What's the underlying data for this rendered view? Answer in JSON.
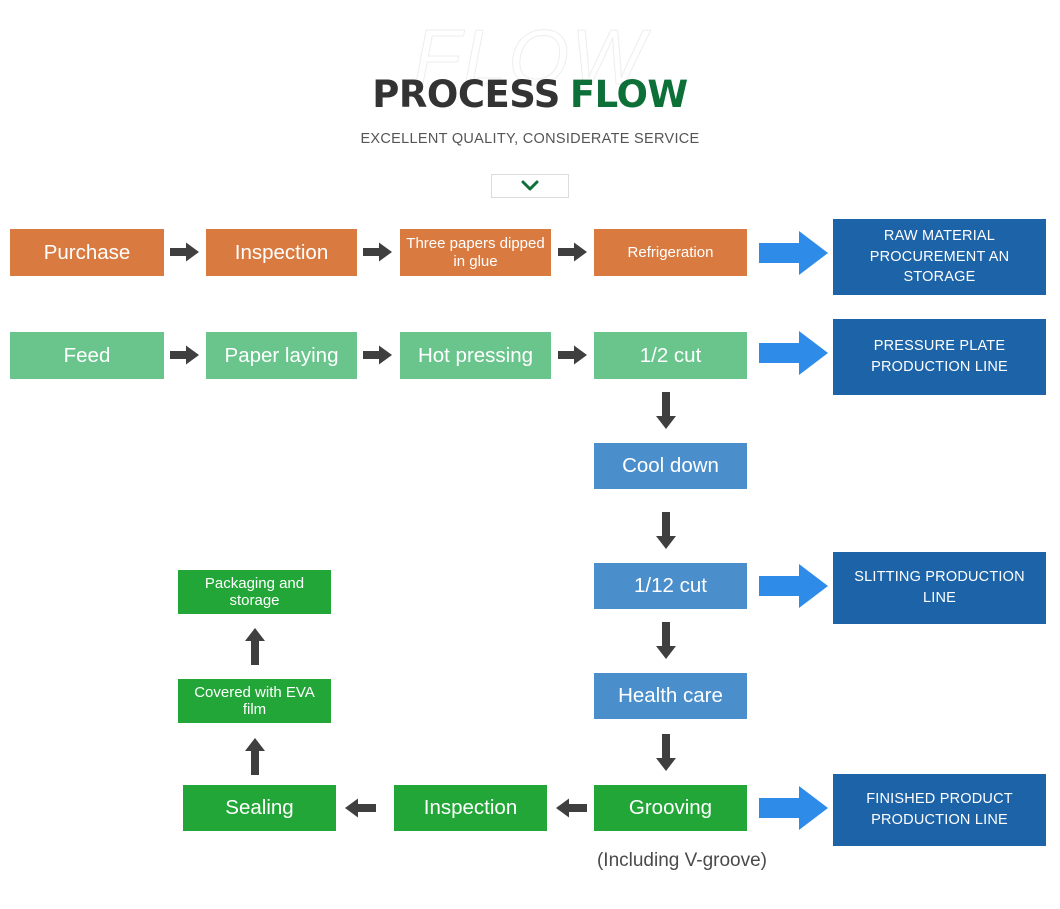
{
  "header": {
    "ghost_title": "FLOW",
    "title_part1": "PROCESS",
    "title_part2": "FLOW",
    "subtitle": "EXCELLENT QUALITY, CONSIDERATE SERVICE",
    "chevron_icon": "chevron-down-icon"
  },
  "colors": {
    "orange": "#d97b40",
    "light_green": "#69c58c",
    "blue": "#4a8ecc",
    "bright_green": "#22a638",
    "banner_blue": "#1c63a8",
    "blue_arrow": "#2e8ce8",
    "dark_arrow": "#3f3f3f",
    "title_dark": "#333333",
    "title_green": "#0d7038"
  },
  "rows": {
    "raw_material": {
      "steps": [
        "Purchase",
        "Inspection",
        "Three papers dipped in glue",
        "Refrigeration"
      ],
      "banner": "RAW MATERIAL PROCUREMENT AN STORAGE"
    },
    "pressure_plate": {
      "steps": [
        "Feed",
        "Paper laying",
        "Hot pressing",
        "1/2 cut"
      ],
      "banner": "PRESSURE PLATE PRODUCTION LINE"
    },
    "slitting": {
      "steps": [
        "Cool down",
        "1/12 cut"
      ],
      "banner": "SLITTING PRODUCTION LINE"
    },
    "finished_product": {
      "steps": [
        "Health care",
        "Grooving",
        "Inspection",
        "Sealing",
        "Covered with EVA film",
        "Packaging and storage"
      ],
      "banner": "FINISHED PRODUCT PRODUCTION LINE"
    }
  },
  "caption": "(Including V-groove)"
}
